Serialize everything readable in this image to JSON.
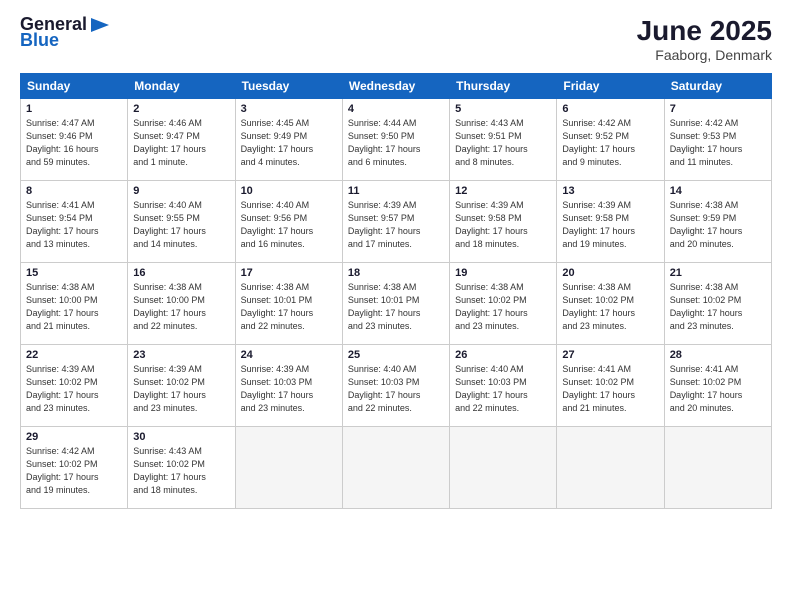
{
  "logo": {
    "general": "General",
    "blue": "Blue"
  },
  "title": "June 2025",
  "location": "Faaborg, Denmark",
  "days_header": [
    "Sunday",
    "Monday",
    "Tuesday",
    "Wednesday",
    "Thursday",
    "Friday",
    "Saturday"
  ],
  "weeks": [
    [
      {
        "day": 1,
        "sunrise": "4:47 AM",
        "sunset": "9:46 PM",
        "daylight": "16 hours and 59 minutes."
      },
      {
        "day": 2,
        "sunrise": "4:46 AM",
        "sunset": "9:47 PM",
        "daylight": "17 hours and 1 minute."
      },
      {
        "day": 3,
        "sunrise": "4:45 AM",
        "sunset": "9:49 PM",
        "daylight": "17 hours and 4 minutes."
      },
      {
        "day": 4,
        "sunrise": "4:44 AM",
        "sunset": "9:50 PM",
        "daylight": "17 hours and 6 minutes."
      },
      {
        "day": 5,
        "sunrise": "4:43 AM",
        "sunset": "9:51 PM",
        "daylight": "17 hours and 8 minutes."
      },
      {
        "day": 6,
        "sunrise": "4:42 AM",
        "sunset": "9:52 PM",
        "daylight": "17 hours and 9 minutes."
      },
      {
        "day": 7,
        "sunrise": "4:42 AM",
        "sunset": "9:53 PM",
        "daylight": "17 hours and 11 minutes."
      }
    ],
    [
      {
        "day": 8,
        "sunrise": "4:41 AM",
        "sunset": "9:54 PM",
        "daylight": "17 hours and 13 minutes."
      },
      {
        "day": 9,
        "sunrise": "4:40 AM",
        "sunset": "9:55 PM",
        "daylight": "17 hours and 14 minutes."
      },
      {
        "day": 10,
        "sunrise": "4:40 AM",
        "sunset": "9:56 PM",
        "daylight": "17 hours and 16 minutes."
      },
      {
        "day": 11,
        "sunrise": "4:39 AM",
        "sunset": "9:57 PM",
        "daylight": "17 hours and 17 minutes."
      },
      {
        "day": 12,
        "sunrise": "4:39 AM",
        "sunset": "9:58 PM",
        "daylight": "17 hours and 18 minutes."
      },
      {
        "day": 13,
        "sunrise": "4:39 AM",
        "sunset": "9:58 PM",
        "daylight": "17 hours and 19 minutes."
      },
      {
        "day": 14,
        "sunrise": "4:38 AM",
        "sunset": "9:59 PM",
        "daylight": "17 hours and 20 minutes."
      }
    ],
    [
      {
        "day": 15,
        "sunrise": "4:38 AM",
        "sunset": "10:00 PM",
        "daylight": "17 hours and 21 minutes."
      },
      {
        "day": 16,
        "sunrise": "4:38 AM",
        "sunset": "10:00 PM",
        "daylight": "17 hours and 22 minutes."
      },
      {
        "day": 17,
        "sunrise": "4:38 AM",
        "sunset": "10:01 PM",
        "daylight": "17 hours and 22 minutes."
      },
      {
        "day": 18,
        "sunrise": "4:38 AM",
        "sunset": "10:01 PM",
        "daylight": "17 hours and 23 minutes."
      },
      {
        "day": 19,
        "sunrise": "4:38 AM",
        "sunset": "10:02 PM",
        "daylight": "17 hours and 23 minutes."
      },
      {
        "day": 20,
        "sunrise": "4:38 AM",
        "sunset": "10:02 PM",
        "daylight": "17 hours and 23 minutes."
      },
      {
        "day": 21,
        "sunrise": "4:38 AM",
        "sunset": "10:02 PM",
        "daylight": "17 hours and 23 minutes."
      }
    ],
    [
      {
        "day": 22,
        "sunrise": "4:39 AM",
        "sunset": "10:02 PM",
        "daylight": "17 hours and 23 minutes."
      },
      {
        "day": 23,
        "sunrise": "4:39 AM",
        "sunset": "10:02 PM",
        "daylight": "17 hours and 23 minutes."
      },
      {
        "day": 24,
        "sunrise": "4:39 AM",
        "sunset": "10:03 PM",
        "daylight": "17 hours and 23 minutes."
      },
      {
        "day": 25,
        "sunrise": "4:40 AM",
        "sunset": "10:03 PM",
        "daylight": "17 hours and 22 minutes."
      },
      {
        "day": 26,
        "sunrise": "4:40 AM",
        "sunset": "10:03 PM",
        "daylight": "17 hours and 22 minutes."
      },
      {
        "day": 27,
        "sunrise": "4:41 AM",
        "sunset": "10:02 PM",
        "daylight": "17 hours and 21 minutes."
      },
      {
        "day": 28,
        "sunrise": "4:41 AM",
        "sunset": "10:02 PM",
        "daylight": "17 hours and 20 minutes."
      }
    ],
    [
      {
        "day": 29,
        "sunrise": "4:42 AM",
        "sunset": "10:02 PM",
        "daylight": "17 hours and 19 minutes."
      },
      {
        "day": 30,
        "sunrise": "4:43 AM",
        "sunset": "10:02 PM",
        "daylight": "17 hours and 18 minutes."
      },
      null,
      null,
      null,
      null,
      null
    ]
  ]
}
